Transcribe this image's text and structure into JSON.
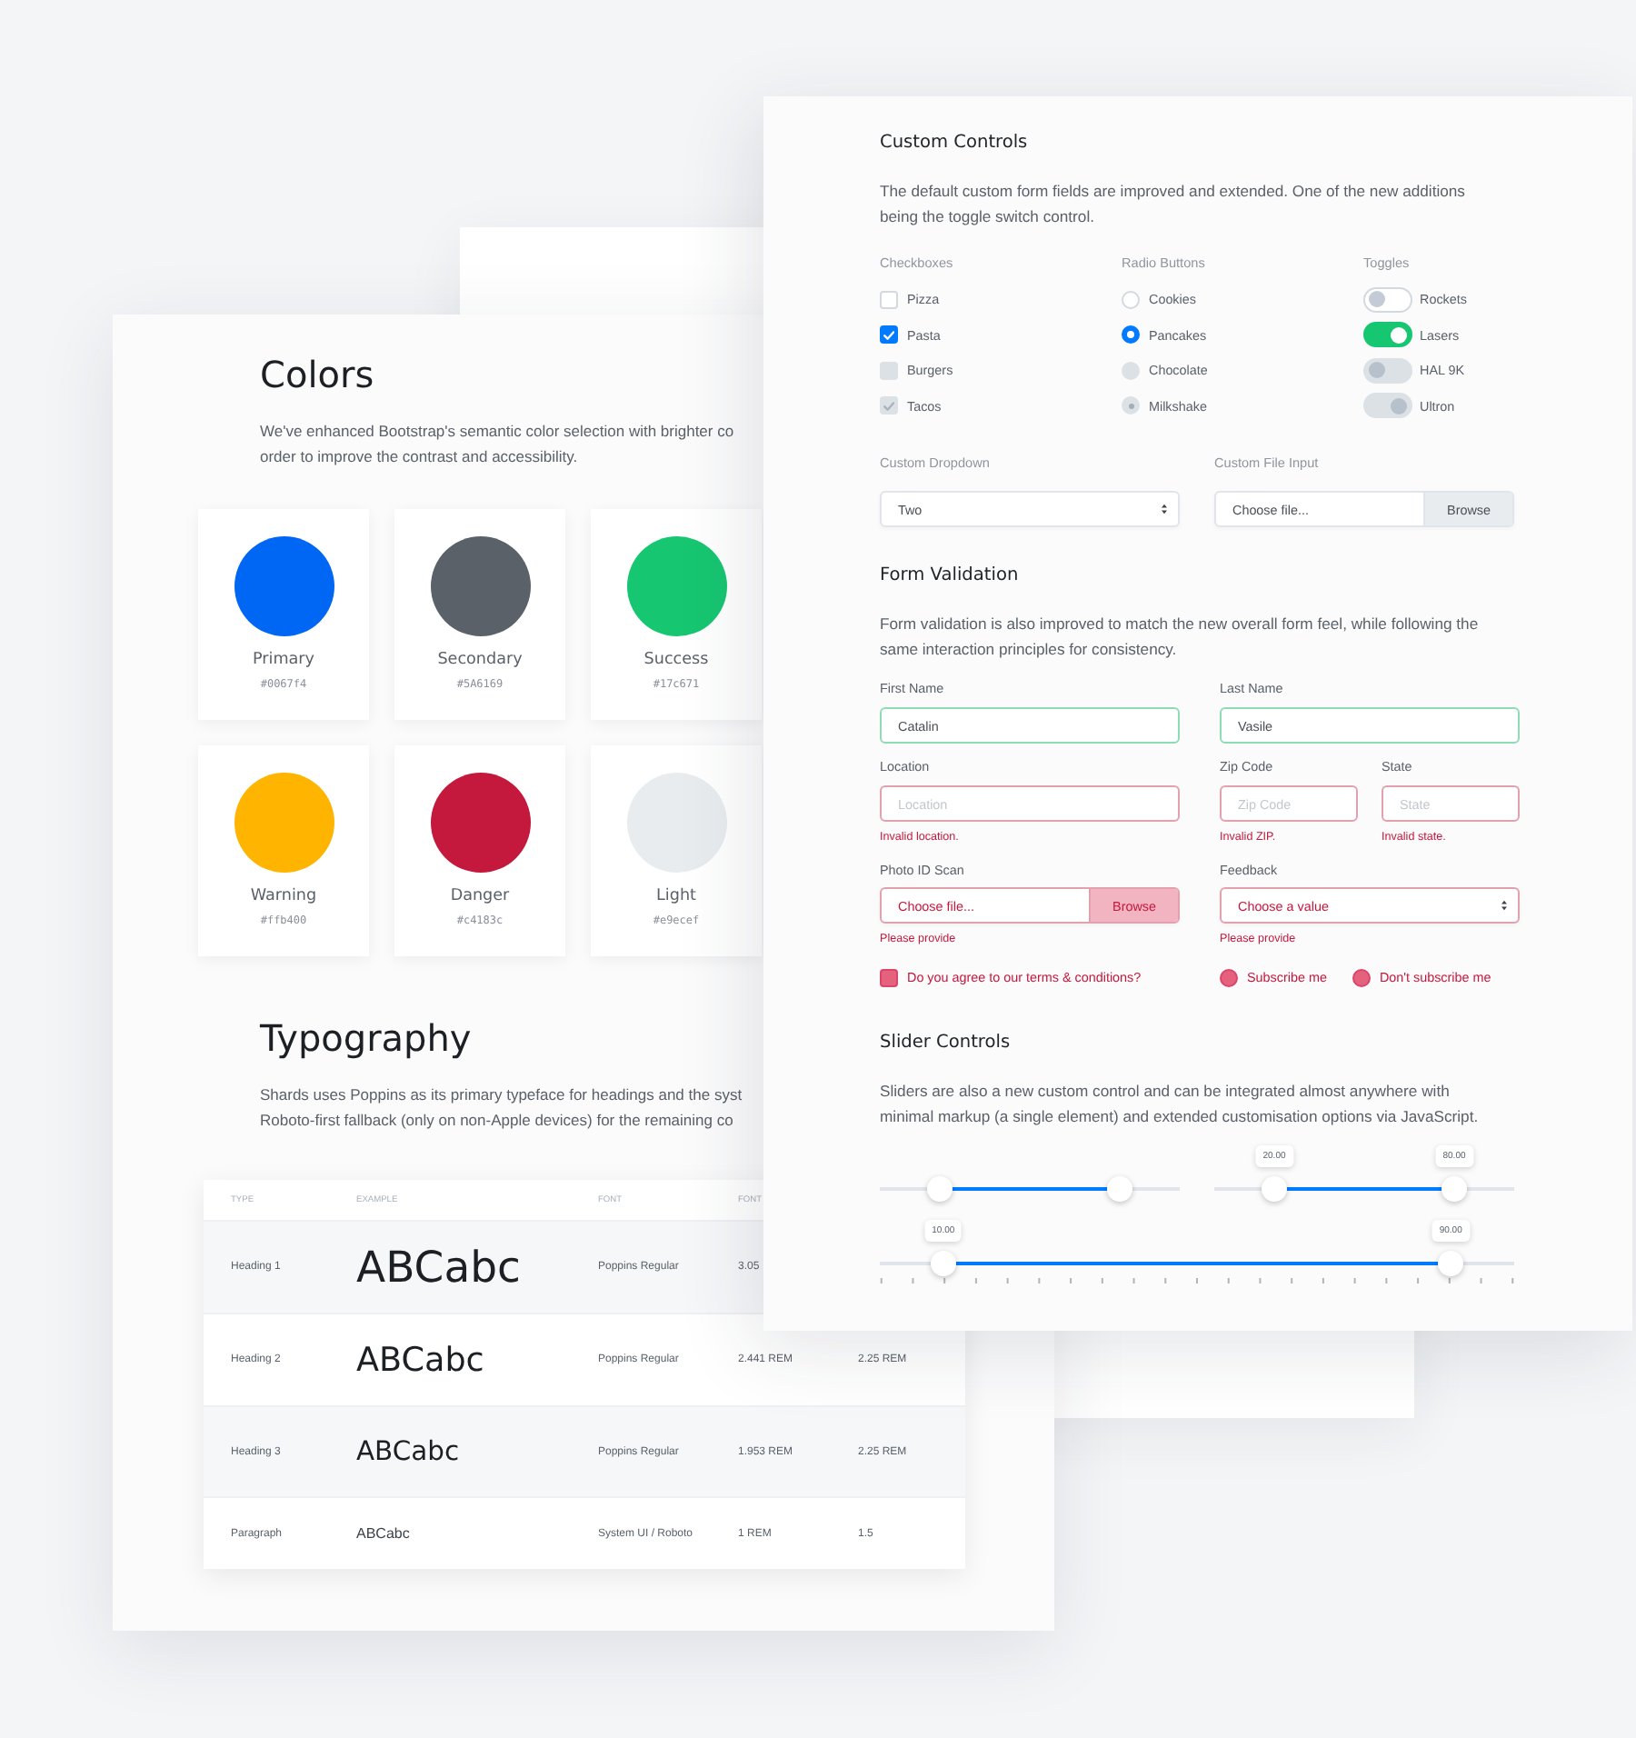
{
  "colors": {
    "title": "Colors",
    "description": [
      "We've enhanced Bootstrap's semantic color selection with brighter co",
      "order to improve the contrast and accessibility."
    ],
    "swatches": [
      {
        "name": "Primary",
        "hex": "#0067f4",
        "color": "#0067f4"
      },
      {
        "name": "Secondary",
        "hex": "#5A6169",
        "color": "#5a6169"
      },
      {
        "name": "Success",
        "hex": "#17c671",
        "color": "#17c671"
      },
      {
        "name": "Warning",
        "hex": "#ffb400",
        "color": "#ffb400"
      },
      {
        "name": "Danger",
        "hex": "#c4183c",
        "color": "#c4183c"
      },
      {
        "name": "Light",
        "hex": "#e9ecef",
        "color": "#e9ecef"
      }
    ]
  },
  "typography": {
    "title": "Typography",
    "description": [
      "Shards uses Poppins as its primary typeface for headings and the syst",
      "Roboto-first fallback (only on non-Apple devices) for the remaining co"
    ],
    "table": {
      "columns": [
        "TYPE",
        "EXAMPLE",
        "FONT",
        "FONT"
      ],
      "rows": [
        {
          "kind": "h1",
          "cells": [
            "Heading 1",
            "ABCabc",
            "Poppins Regular",
            "3.05"
          ]
        },
        {
          "kind": "h2",
          "cells": [
            "Heading 2",
            "ABCabc",
            "Poppins Regular",
            "2.441 REM",
            "2.25 REM"
          ]
        },
        {
          "kind": "h3",
          "cells": [
            "Heading 3",
            "ABCabc",
            "Poppins Regular",
            "1.953 REM",
            "2.25 REM"
          ]
        },
        {
          "kind": "paragraph",
          "cells": [
            "Paragraph",
            "ABCabc",
            "System UI / Roboto",
            "1 REM",
            "1.5"
          ]
        }
      ]
    }
  },
  "custom_controls": {
    "title": "Custom Controls",
    "description": [
      "The default custom form fields are improved and extended. One of the new additions",
      "being the toggle switch control."
    ],
    "checkboxes": {
      "label": "Checkboxes",
      "items": [
        {
          "label": "Pizza",
          "checked": false,
          "disabled": false
        },
        {
          "label": "Pasta",
          "checked": true,
          "disabled": false
        },
        {
          "label": "Burgers",
          "checked": false,
          "disabled": true
        },
        {
          "label": "Tacos",
          "checked": true,
          "disabled": true
        }
      ]
    },
    "radios": {
      "label": "Radio Buttons",
      "items": [
        {
          "label": "Cookies",
          "selected": false,
          "disabled": false
        },
        {
          "label": "Pancakes",
          "selected": true,
          "disabled": false
        },
        {
          "label": "Chocolate",
          "selected": false,
          "disabled": true
        },
        {
          "label": "Milkshake",
          "selected": true,
          "disabled": true
        }
      ]
    },
    "toggles": {
      "label": "Toggles",
      "items": [
        {
          "label": "Rockets",
          "on": false,
          "disabled": false
        },
        {
          "label": "Lasers",
          "on": true,
          "disabled": false
        },
        {
          "label": "HAL 9K",
          "on": false,
          "disabled": true
        },
        {
          "label": "Ultron",
          "on": true,
          "disabled": true
        }
      ]
    },
    "dropdown": {
      "label": "Custom Dropdown",
      "value": "Two"
    },
    "file_input": {
      "label": "Custom File Input",
      "text": "Choose file...",
      "button": "Browse"
    }
  },
  "form_validation": {
    "title": "Form Validation",
    "description": [
      "Form validation is also improved to match the new overall form feel, while following the",
      "same interaction principles for consistency."
    ],
    "rows": [
      [
        {
          "kind": "text",
          "label": "First Name",
          "value": "Catalin",
          "invalid": false
        },
        {
          "kind": "text",
          "label": "Last Name",
          "value": "Vasile",
          "invalid": false
        }
      ],
      [
        {
          "kind": "text",
          "label": "Location",
          "placeholder": "Location",
          "invalid": true,
          "error": "Invalid location."
        },
        {
          "kind": "text",
          "label": "Zip Code",
          "placeholder": "Zip Code",
          "invalid": true,
          "error": "Invalid ZIP."
        },
        {
          "kind": "text",
          "label": "State",
          "placeholder": "State",
          "invalid": true,
          "error": "Invalid state."
        }
      ],
      [
        {
          "kind": "file",
          "label": "Photo ID Scan",
          "text": "Choose file...",
          "button": "Browse",
          "invalid": true,
          "error": "Please provide"
        },
        {
          "kind": "select",
          "label": "Feedback",
          "value": "Choose a value",
          "invalid": true,
          "error": "Please provide"
        }
      ]
    ],
    "agreement": {
      "checkbox": {
        "label": "Do you agree to our terms & conditions?",
        "checked": false,
        "invalid": true
      },
      "radios": [
        {
          "label": "Subscribe me",
          "selected": false,
          "invalid": true
        },
        {
          "label": "Don't subscribe me",
          "selected": false,
          "invalid": true
        }
      ]
    }
  },
  "slider_controls": {
    "title": "Slider Controls",
    "description": [
      "Sliders are also a new custom control and can be integrated almost anywhere with",
      "minimal markup (a single element) and extended customisation options via JavaScript."
    ],
    "sliders": [
      {
        "ticks": false,
        "handles": [
          {
            "level": 0.2
          },
          {
            "level": 0.8
          }
        ]
      },
      {
        "ticks": false,
        "handles": [
          {
            "level": 0.2,
            "label": "20.00"
          },
          {
            "level": 0.8,
            "label": "80.00"
          }
        ]
      },
      {
        "ticks": true,
        "handles": [
          {
            "level": 0.1,
            "label": "10.00"
          },
          {
            "level": 0.9,
            "label": "90.00"
          }
        ]
      }
    ]
  }
}
